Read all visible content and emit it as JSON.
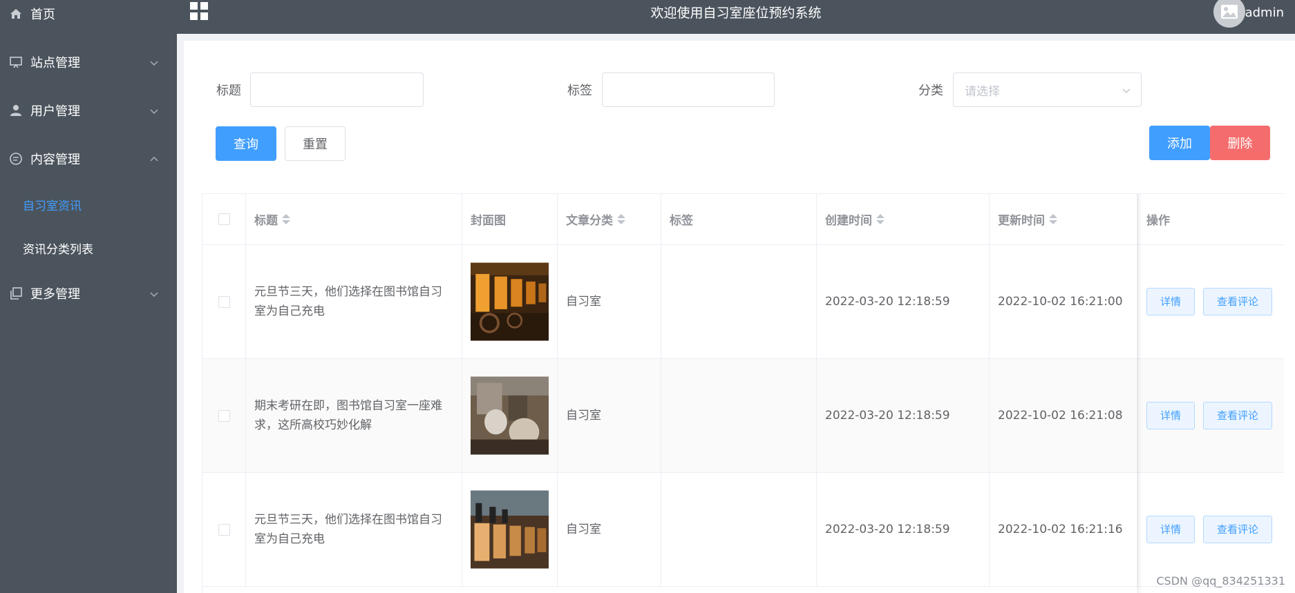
{
  "app": {
    "title": "欢迎使用自习室座位预约系统",
    "username": "admin"
  },
  "sidebar": {
    "items": [
      {
        "label": "首页",
        "icon": "home-icon"
      },
      {
        "label": "站点管理",
        "icon": "monitor-icon"
      },
      {
        "label": "用户管理",
        "icon": "user-icon"
      },
      {
        "label": "内容管理",
        "icon": "chat-icon",
        "expanded": true,
        "children": [
          {
            "label": "自习室资讯",
            "active": true
          },
          {
            "label": "资讯分类列表",
            "active": false
          }
        ]
      },
      {
        "label": "更多管理",
        "icon": "copy-icon"
      }
    ]
  },
  "search": {
    "title_label": "标题",
    "tag_label": "标签",
    "category_label": "分类",
    "category_placeholder": "请选择",
    "query_button": "查询",
    "reset_button": "重置",
    "add_button": "添加",
    "delete_button": "删除"
  },
  "table": {
    "columns": [
      "标题",
      "封面图",
      "文章分类",
      "标签",
      "创建时间",
      "更新时间",
      "操作"
    ],
    "rows": [
      {
        "title": "元旦节三天，他们选择在图书馆自习室为自己充电",
        "category": "自习室",
        "tag": "",
        "created": "2022-03-20 12:18:59",
        "updated": "2022-10-02 16:21:00"
      },
      {
        "title": "期末考研在即，图书馆自习室一座难求，这所高校巧妙化解",
        "category": "自习室",
        "tag": "",
        "created": "2022-03-20 12:18:59",
        "updated": "2022-10-02 16:21:08"
      },
      {
        "title": "元旦节三天，他们选择在图书馆自习室为自己充电",
        "category": "自习室",
        "tag": "",
        "created": "2022-03-20 12:18:59",
        "updated": "2022-10-02 16:21:16"
      }
    ],
    "detail_button": "详情",
    "comment_button": "查看评论"
  },
  "watermark": "CSDN @qq_834251331",
  "colors": {
    "sidebar_bg": "#4b545d",
    "primary": "#409eff",
    "danger": "#f56c6c",
    "active_menu": "#409eff"
  }
}
